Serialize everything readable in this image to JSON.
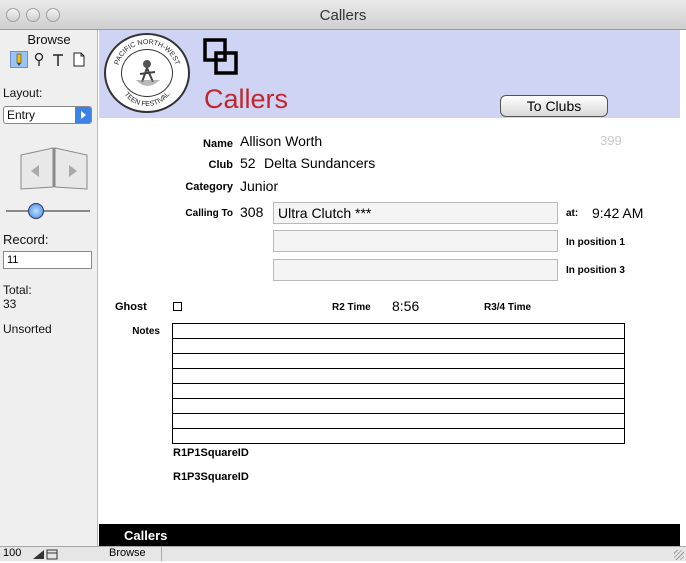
{
  "window": {
    "title": "Callers"
  },
  "status_panel": {
    "mode": "Browse",
    "layout_label": "Layout:",
    "layout_value": "Entry",
    "record_label": "Record:",
    "record_value": "11",
    "total_label": "Total:",
    "total_value": "33",
    "sort_state": "Unsorted"
  },
  "header": {
    "title": "Callers",
    "to_clubs_button": "To Clubs",
    "logo_icon": "pacific-northwest-teen-festival-logo"
  },
  "record": {
    "name_label": "Name",
    "name_value": "Allison Worth",
    "record_number": "399",
    "club_label": "Club",
    "club_number": "52",
    "club_name": "Delta Sundancers",
    "category_label": "Category",
    "category_value": "Junior",
    "calling_to_label": "Calling To",
    "calling_to_number": "308",
    "calling_to_name": "Ultra Clutch ***",
    "at_label": "at:",
    "at_value": "9:42 AM",
    "in_position_1_label": "In position 1",
    "in_position_3_label": "In position 3",
    "ghost_label": "Ghost",
    "r2_time_label": "R2 Time",
    "r2_time_value": "8:56",
    "r34_time_label": "R3/4 Time",
    "r34_time_value": "",
    "notes_label": "Notes",
    "r1p1_label": "R1P1SquareID",
    "r1p3_label": "R1P3SquareID"
  },
  "footer": {
    "layout_part_label": "Callers",
    "zoom": "100",
    "mode_status": "Browse"
  },
  "colors": {
    "header_band": "#cfd3f4",
    "title_red": "#c0272d"
  }
}
